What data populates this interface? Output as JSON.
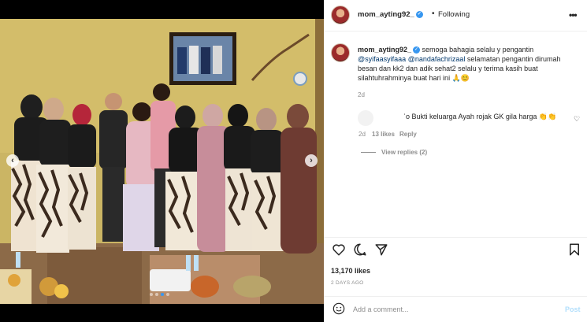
{
  "post": {
    "username": "mom_ayting92_",
    "follow_state": "Following",
    "separator": "•",
    "caption": {
      "username": "mom_ayting92_",
      "text_1": "semoga bahagia selalu y pengantin",
      "mention_1": "@syifaasyifaaa",
      "mention_2": "@nandafachrizaal",
      "text_2": "selamatan pengantin dirumah besan dan kk2 dan adik sehat2 selalu y terima kasih buat silahtuhrahminya buat hari ini 🙏😊",
      "time": "2d"
    },
    "comment": {
      "text": "ʾo Bukti keluarga Ayah rojak GK gila harga 👏👏",
      "time": "2d",
      "likes": "13 likes",
      "reply": "Reply",
      "view_replies": "View replies (2)"
    },
    "likes": "13,170 likes",
    "date": "2 DAYS AGO",
    "add_comment_placeholder": "Add a comment...",
    "post_label": "Post"
  },
  "icons": {
    "more": "more-options-icon",
    "like": "heart-icon",
    "comment": "comment-icon",
    "share": "share-icon",
    "save": "bookmark-icon",
    "emoji": "emoji-icon",
    "nav_prev": "chevron-left-icon",
    "nav_next": "chevron-right-icon"
  },
  "carousel": {
    "current": 3,
    "total": 4
  },
  "colors": {
    "accent": "#3897f0",
    "post_disabled": "#b2dffc",
    "muted": "#8e8e8e",
    "wall": "#c9b25e"
  }
}
